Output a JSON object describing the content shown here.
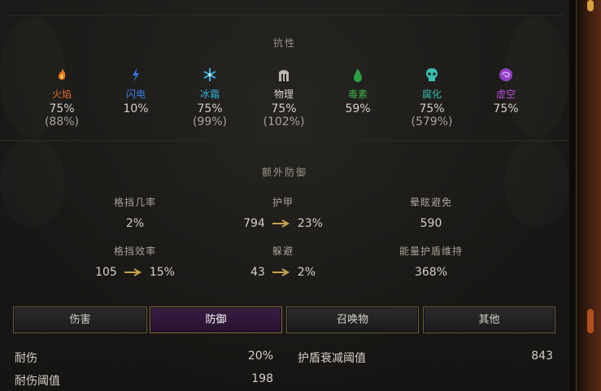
{
  "resistances": {
    "title": "抗性",
    "items": [
      {
        "id": "fire",
        "label": "火焰",
        "value": "75%",
        "max": "(88%)",
        "color": "#e06a2a",
        "icon": "flame-icon"
      },
      {
        "id": "lightning",
        "label": "闪电",
        "value": "10%",
        "max": "",
        "color": "#3a7ae0",
        "icon": "lightning-icon"
      },
      {
        "id": "cold",
        "label": "冰霜",
        "value": "75%",
        "max": "(99%)",
        "color": "#3ab0e0",
        "icon": "snowflake-icon"
      },
      {
        "id": "physical",
        "label": "物理",
        "value": "75%",
        "max": "(102%)",
        "color": "#d6d1c6",
        "icon": "physical-icon"
      },
      {
        "id": "poison",
        "label": "毒素",
        "value": "59%",
        "max": "",
        "color": "#3ab04a",
        "icon": "poison-drop-icon"
      },
      {
        "id": "necrotic",
        "label": "腐化",
        "value": "75%",
        "max": "(579%)",
        "color": "#3ac0b0",
        "icon": "skull-icon"
      },
      {
        "id": "void",
        "label": "虚空",
        "value": "75%",
        "max": "",
        "color": "#b050d0",
        "icon": "void-icon"
      }
    ]
  },
  "extra_defense": {
    "title": "额外防御",
    "block_chance": {
      "label": "格挡几率",
      "value": "2%"
    },
    "armor": {
      "label": "护甲",
      "from": "794",
      "to": "23%"
    },
    "stun_avoid": {
      "label": "晕眩避免",
      "value": "590"
    },
    "block_effect": {
      "label": "格挡效率",
      "from": "105",
      "to": "15%"
    },
    "dodge": {
      "label": "躲避",
      "from": "43",
      "to": "2%"
    },
    "ward_retention": {
      "label": "能量护盾维持",
      "value": "368%"
    }
  },
  "tabs": [
    {
      "label": "伤害",
      "active": false
    },
    {
      "label": "防御",
      "active": true
    },
    {
      "label": "召唤物",
      "active": false
    },
    {
      "label": "其他",
      "active": false
    }
  ],
  "stats": {
    "endurance": {
      "label": "耐伤",
      "value": "20%"
    },
    "endurance_threshold": {
      "label": "耐伤阈值",
      "value": "198"
    },
    "ward_decay_threshold": {
      "label": "护盾衰减阈值",
      "value": "843"
    }
  },
  "colors": {
    "accent_gold": "#c9a24a",
    "active_tab": "#3a1f45"
  }
}
